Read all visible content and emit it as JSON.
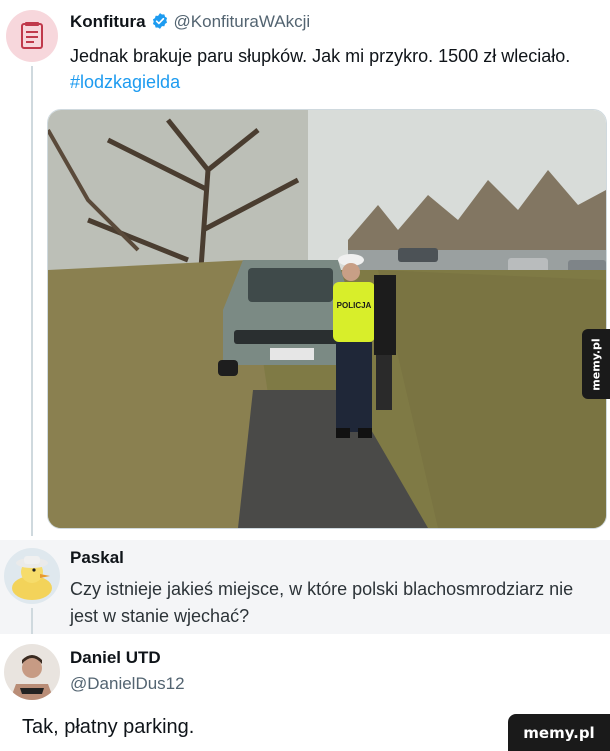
{
  "tweets": [
    {
      "name": "Konfitura",
      "handle": "@KonfituraWAkcji",
      "text": "Jednak brakuje paru słupków. Jak mi przykro. 1500 zł wleciało.",
      "hashtag": "#lodzkagielda",
      "verified": true,
      "avatar_icon": "document-icon",
      "photo": {
        "description_icon": "photo",
        "vest_text": "POLICJA"
      }
    },
    {
      "name": "Paskal",
      "text": "Czy istnieje jakieś miejsce, w które polski blachosmrodziarz nie jest w stanie wjechać?",
      "avatar_icon": "duck-avatar"
    },
    {
      "name": "Daniel UTD",
      "handle": "@DanielDus12",
      "text": "Tak, płatny parking.",
      "avatar_icon": "man-avatar"
    }
  ],
  "watermarks": {
    "side": "memy.pl",
    "bottom": "memy.pl"
  },
  "colors": {
    "link": "#1d9bf0",
    "verified": "#1d9bf0",
    "handle": "#536471",
    "reply_bg": "#f4f5f7"
  }
}
